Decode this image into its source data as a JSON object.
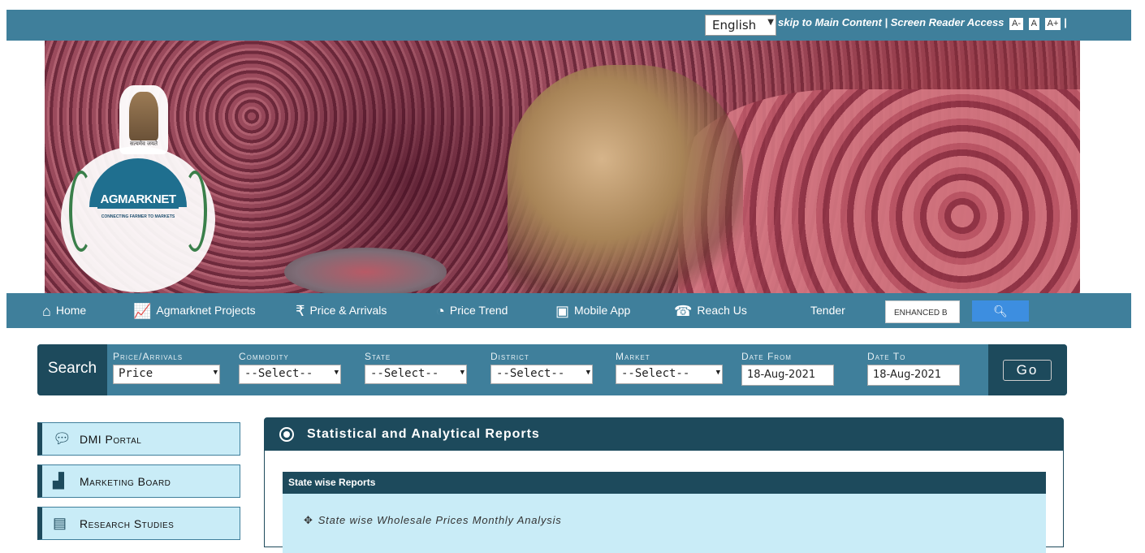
{
  "topbar": {
    "language": "English",
    "skip_text": "skip to Main Content | Screen Reader Access",
    "font_small": "A-",
    "font_normal": "A",
    "font_large": "A+",
    "separator": "|"
  },
  "logo": {
    "emblem_text": "सत्यमेव जयते",
    "name": "AGMARKNET",
    "tagline": "CONNECTING FARMER TO MARKETS"
  },
  "nav": {
    "items": [
      {
        "label": "Home",
        "icon": "home-icon"
      },
      {
        "label": "Agmarknet Projects",
        "icon": "chart-icon"
      },
      {
        "label": "Price & Arrivals",
        "icon": "rupee-icon"
      },
      {
        "label": "Price Trend",
        "icon": "trend-icon"
      },
      {
        "label": "Mobile App",
        "icon": "android-icon"
      },
      {
        "label": "Reach Us",
        "icon": "phone-icon"
      },
      {
        "label": "Tender",
        "icon": ""
      }
    ],
    "search_placeholder": "ENHANCED B",
    "search_button_icon": "search-icon"
  },
  "search": {
    "label": "Search",
    "fields": [
      {
        "label": "Price/Arrivals",
        "value": "Price"
      },
      {
        "label": "Commodity",
        "value": "--Select--"
      },
      {
        "label": "State",
        "value": "--Select--"
      },
      {
        "label": "District",
        "value": "--Select--"
      },
      {
        "label": "Market",
        "value": "--Select--"
      },
      {
        "label": "Date From",
        "value": "18-Aug-2021"
      },
      {
        "label": "Date To",
        "value": "18-Aug-2021"
      }
    ],
    "go_label": "Go"
  },
  "sidebar": {
    "items": [
      {
        "label": "DMI Portal",
        "icon": "chat-icon"
      },
      {
        "label": "Marketing Board",
        "icon": "bar-chart-icon"
      },
      {
        "label": "Research Studies",
        "icon": "analytics-icon"
      }
    ]
  },
  "panel": {
    "title": "Statistical and Analytical Reports",
    "section_title": "State wise Reports",
    "links": [
      "State wise Wholesale Prices Monthly Analysis"
    ]
  }
}
